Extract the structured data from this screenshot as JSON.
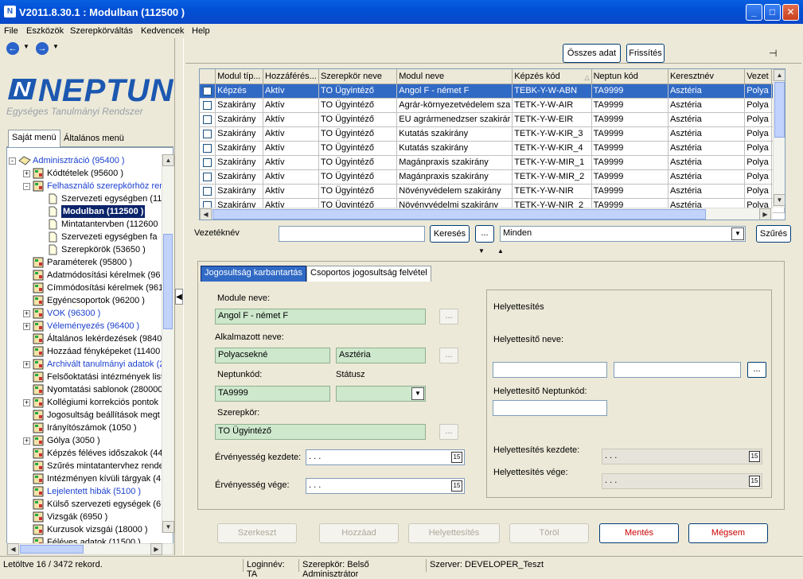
{
  "window": {
    "title": "V2011.8.30.1 : Modulban (112500  )",
    "icon": "neptun-app-icon",
    "controls": [
      "minimize",
      "maximize",
      "close"
    ]
  },
  "menu": [
    "File",
    "Eszközök",
    "Szerepkörváltás",
    "Kedvencek",
    "Help"
  ],
  "logo": {
    "name": "NEPTUN",
    "subtitle": "Egységes Tanulmányi Rendszer"
  },
  "side_tabs": [
    "Saját menü",
    "Általános menü"
  ],
  "tree": [
    {
      "label": "Adminisztráció (95400  )",
      "level": 0,
      "exp": "-",
      "blue": true
    },
    {
      "label": "Kódtételek (95600  )",
      "level": 1,
      "exp": "+"
    },
    {
      "label": "Felhasználó szerepkörhöz ren",
      "level": 1,
      "exp": "-",
      "blue": true
    },
    {
      "label": "Szervezeti egységben (11",
      "level": 2,
      "doc": true
    },
    {
      "label": "Modulban (112500  )",
      "level": 2,
      "doc": true,
      "selected": true
    },
    {
      "label": "Mintatantervben (112600",
      "level": 2,
      "doc": true
    },
    {
      "label": "Szervezeti egységben fa",
      "level": 2,
      "doc": true
    },
    {
      "label": "Szerepkörök (53650  )",
      "level": 2,
      "doc": true
    },
    {
      "label": "Paraméterek (95800  )",
      "level": 1
    },
    {
      "label": "Adatmódosítási kérelmek (96",
      "level": 1
    },
    {
      "label": "Címmódosítási kérelmek (961",
      "level": 1
    },
    {
      "label": "Egyéncsoportok (96200  )",
      "level": 1
    },
    {
      "label": "VOK (96300  )",
      "level": 1,
      "exp": "+",
      "blue": true
    },
    {
      "label": "Véleményezés (96400  )",
      "level": 1,
      "exp": "+",
      "blue": true
    },
    {
      "label": "Általános lekérdezések (9840",
      "level": 1
    },
    {
      "label": "Hozzáad fényképeket (11400",
      "level": 1
    },
    {
      "label": "Archivált tanulmányi adatok (2",
      "level": 1,
      "exp": "+",
      "blue": true
    },
    {
      "label": "Felsőoktatási intézmények list",
      "level": 1
    },
    {
      "label": "Nyomtatási sablonok (280000",
      "level": 1
    },
    {
      "label": "Kollégiumi korrekciós pontok",
      "level": 1,
      "exp": "+"
    },
    {
      "label": "Jogosultság beállítások megt",
      "level": 1
    },
    {
      "label": "Irányítószámok (1050  )",
      "level": 1
    },
    {
      "label": "Gólya (3050  )",
      "level": 1,
      "exp": "+"
    },
    {
      "label": "Képzés féléves időszakok (44",
      "level": 1
    },
    {
      "label": "Szűrés mintatantervhez rende",
      "level": 1
    },
    {
      "label": "Intézményen kívüli tárgyak (4",
      "level": 1
    },
    {
      "label": "Lejelentett hibák (5100  )",
      "level": 1,
      "blue": true
    },
    {
      "label": "Külső szervezeti egységek (6",
      "level": 1
    },
    {
      "label": "Vizsgák (6950  )",
      "level": 1
    },
    {
      "label": "Kurzusok vizsgái (18000  )",
      "level": 1
    },
    {
      "label": "Féléves adatok (11500  )",
      "level": 1
    }
  ],
  "toolbar": {
    "all_data": "Összes adat",
    "refresh": "Frissítés",
    "pin_icon": "pin-icon"
  },
  "grid": {
    "columns": [
      "Modul típ...",
      "Hozzáférés...",
      "Szerepkör neve",
      "Modul neve",
      "Képzés kód",
      "Neptun kód",
      "Keresztnév",
      "Vezet"
    ],
    "rows": [
      [
        "Képzés",
        "Aktív",
        "TO Ügyintéző",
        "Angol F - német F",
        "TEBK-Y-W-ABN",
        "TA9999",
        "Asztéria",
        "Polya"
      ],
      [
        "Szakirány",
        "Aktív",
        "TO Ügyintéző",
        "Agrár-környezetvédelem sza",
        "TETK-Y-W-AIR",
        "TA9999",
        "Asztéria",
        "Polya"
      ],
      [
        "Szakirány",
        "Aktív",
        "TO Ügyintéző",
        "EU agrármenedzser szakirár",
        "TETK-Y-W-EIR",
        "TA9999",
        "Asztéria",
        "Polya"
      ],
      [
        "Szakirány",
        "Aktív",
        "TO Ügyintéző",
        "Kutatás szakirány",
        "TETK-Y-W-KIR_3",
        "TA9999",
        "Asztéria",
        "Polya"
      ],
      [
        "Szakirány",
        "Aktív",
        "TO Ügyintéző",
        "Kutatás szakirány",
        "TETK-Y-W-KIR_4",
        "TA9999",
        "Asztéria",
        "Polya"
      ],
      [
        "Szakirány",
        "Aktív",
        "TO Ügyintéző",
        "Magánpraxis szakirány",
        "TETK-Y-W-MIR_1",
        "TA9999",
        "Asztéria",
        "Polya"
      ],
      [
        "Szakirány",
        "Aktív",
        "TO Ügyintéző",
        "Magánpraxis szakirány",
        "TETK-Y-W-MIR_2",
        "TA9999",
        "Asztéria",
        "Polya"
      ],
      [
        "Szakirány",
        "Aktív",
        "TO Ügyintéző",
        "Növényvédelem szakirány",
        "TETK-Y-W-NIR",
        "TA9999",
        "Asztéria",
        "Polya"
      ],
      [
        "Szakirány",
        "Aktív",
        "TO Ügyintéző",
        "Növényvédelmi szakirány",
        "TETK-Y-W-NIR_2",
        "TA9999",
        "Asztéria",
        "Polya"
      ]
    ]
  },
  "filter": {
    "label": "Vezetéknév",
    "search": "Keresés",
    "ellipsis": "...",
    "select_value": "Minden",
    "filter_btn": "Szűrés"
  },
  "form": {
    "tabs": [
      "Jogosultság karbantartás",
      "Csoportos jogosultság felvétel"
    ],
    "module_label": "Module neve:",
    "module_value": "Angol F - német F",
    "employee_label": "Alkalmazott neve:",
    "employee_last": "Polyacsekné",
    "employee_first": "Asztéria",
    "neptun_label": "Neptunkód:",
    "neptun_value": "TA9999",
    "status_label": "Státusz",
    "role_label": "Szerepkör:",
    "role_value": "TO Ügyintéző",
    "valid_from_label": "Érvényesség kezdete:",
    "valid_to_label": "Érvényesség vége:",
    "date_placeholder": " .   .   .",
    "cal_icon": "15",
    "sub_title": "Helyettesítés",
    "sub_name_label": "Helyettesítő neve:",
    "sub_neptun_label": "Helyettesítő Neptunkód:",
    "sub_from_label": "Helyettesítés kezdete:",
    "sub_to_label": "Helyettesítés vége:"
  },
  "actions": [
    "Szerkeszt",
    "Hozzáad",
    "Helyettesítés",
    "Töröl",
    "Mentés",
    "Mégsem"
  ],
  "status": {
    "records": "Letöltve 16 / 3472 rekord.",
    "login": "Loginnév: TA",
    "role": "Szerepkör: Belső Adminisztrátor",
    "server": "Szerver: DEVELOPER_Teszt"
  }
}
